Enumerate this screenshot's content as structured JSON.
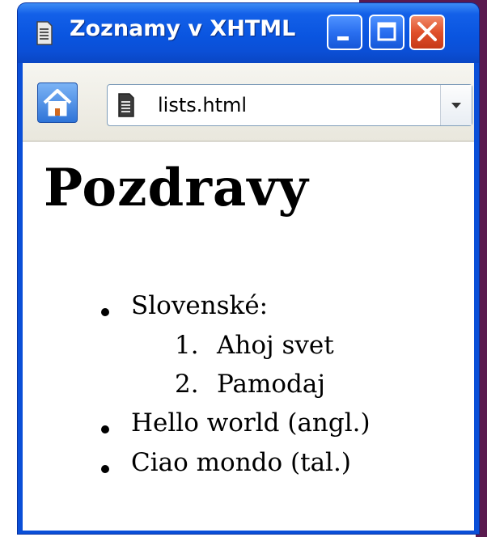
{
  "window": {
    "title": "Zoznamy v XHTML",
    "controls": {
      "minimize": "minimize",
      "maximize": "maximize",
      "close": "close"
    }
  },
  "toolbar": {
    "address": "lists.html",
    "home_icon": "home-icon",
    "page_icon": "document-icon",
    "dropdown_icon": "chevron-down-icon"
  },
  "content": {
    "heading": "Pozdravy",
    "list": [
      {
        "text": "Slovenské:",
        "sublist": [
          {
            "number": "1.",
            "text": "Ahoj svet"
          },
          {
            "number": "2.",
            "text": "Pamodaj"
          }
        ]
      },
      {
        "text": "Hello world (angl.)"
      },
      {
        "text": "Ciao mondo (tal.)"
      }
    ]
  },
  "colors": {
    "titlebar": "#0a55e0",
    "close": "#e0502a",
    "accent": "#2f74d8"
  }
}
